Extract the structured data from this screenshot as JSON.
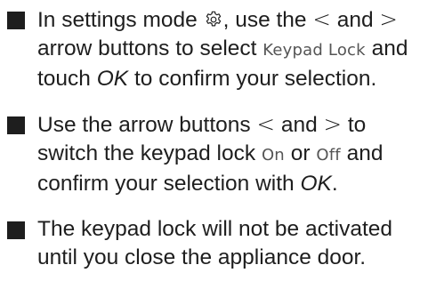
{
  "colors": {
    "text": "#1e1e1e",
    "display_text": "#555555",
    "bullet": "#1e1e1e"
  },
  "instructions": [
    {
      "p1": "In settings mode ",
      "icon": "gear-icon",
      "p2": ", use the ",
      "left_arrow": "<",
      "p3": " and ",
      "right_arrow": ">",
      "p4": " arrow buttons to select ",
      "display_term": "Keypad Lock",
      "p5": " and touch ",
      "ok_label": "OK",
      "p6": " to confirm your selec­tion."
    },
    {
      "p1": "Use the arrow buttons ",
      "left_arrow": "<",
      "p2": " and ",
      "right_arrow": ">",
      "p3": " to switch the keypad lock ",
      "on_label": "On",
      "p4": " or ",
      "off_label": "Off",
      "p5": " and confirm your selection with ",
      "ok_label": "OK",
      "p6": "."
    },
    {
      "text": "The keypad lock will not be activated until you close the appliance door."
    }
  ]
}
